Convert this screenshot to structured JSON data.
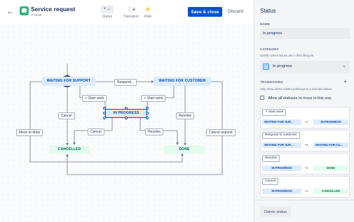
{
  "header": {
    "back_icon": "arrow-left-icon",
    "app_icon": "chat-bubble-icon",
    "title": "Service request",
    "subtitle": "IT Desk",
    "tools": [
      {
        "label": "Status",
        "icon": "plus-chevron-icon",
        "glyph": "+ ⌄"
      },
      {
        "label": "Transition",
        "icon": "transition-icon",
        "glyph": "⋮≡"
      },
      {
        "label": "Rule",
        "icon": "lightning-icon",
        "glyph": "⚡"
      }
    ],
    "save_label": "Save & close",
    "discard_label": "Discard"
  },
  "diagram": {
    "start": "START",
    "nodes": {
      "waiting_support": "WAITING FOR SUPPORT",
      "waiting_customer": "WAITING FOR CUSTOMER",
      "in_progress": "IN PROGRESS",
      "cancelled": "CANCELLED",
      "done": "DONE"
    },
    "labels": {
      "respond": "Respond...",
      "start_work_1": "Start work",
      "start_work_2": "Start work",
      "cancel_1": "Cancel",
      "cancel_2": "Cancel",
      "resolve_1": "Resolve",
      "resolve_2": "Resolve",
      "move_to_done": "Move to done",
      "cancel_request": "Cancel request"
    }
  },
  "panel": {
    "title": "Status",
    "name_label": "NAME",
    "name_value": "In progress",
    "category_label": "CATEGORY",
    "category_help": "Identify where issues are in their lifecycle.",
    "category_value": "In progress",
    "transitions_label": "TRANSITIONS",
    "transitions_help": "Help show all the related pathways to a selected status.",
    "allow_all_label": "Allow all statuses to move to this one.",
    "transitions": [
      {
        "name": "Start work",
        "has_bolt": true,
        "from": "WAITING FOR SUP...",
        "to": "IN PROGRESS",
        "from_color": "#deebff",
        "to_color": "#deebff",
        "from_text": "#0747a6",
        "to_text": "#0747a6"
      },
      {
        "name": "Respond to customer",
        "has_bolt": false,
        "from": "WAITING FOR SUP...",
        "to": "WAITING FOR CU...",
        "from_color": "#deebff",
        "to_color": "#deebff",
        "from_text": "#0747a6",
        "to_text": "#0747a6"
      },
      {
        "name": "Resolve",
        "has_bolt": false,
        "from": "IN PROGRESS",
        "to": "DONE",
        "from_color": "#deebff",
        "to_color": "#e3fcef",
        "from_text": "#0747a6",
        "to_text": "#006644"
      },
      {
        "name": "Cancel",
        "has_bolt": false,
        "from": "IN PROGRESS",
        "to": "CANCELLED",
        "from_color": "#deebff",
        "to_color": "#e3fcef",
        "from_text": "#0747a6",
        "to_text": "#006644"
      }
    ],
    "delete_label": "Delete status"
  },
  "colors": {
    "primary": "#0052cc",
    "blue_lozenge": "#deebff",
    "green_lozenge": "#e3fcef",
    "app_green": "#36b37e"
  }
}
